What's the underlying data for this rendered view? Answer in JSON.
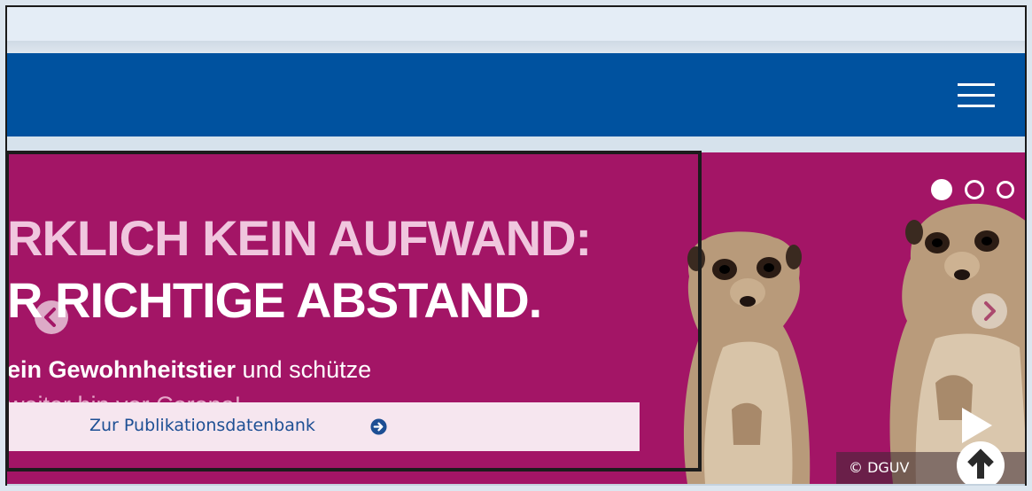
{
  "header": {
    "menu_icon": "hamburger-menu-icon",
    "colors": {
      "bar": "#00529f",
      "topbar": "#e4edf6"
    }
  },
  "hero": {
    "background": "#a31566",
    "headline_line1": "RKLICH KEIN AUFWAND:",
    "headline_line2": "R RICHTIGE ABSTAND.",
    "subline_bold": "ein Gewohnheitstier",
    "subline_rest": " und schütze",
    "subline_faded": "weiter hin vor Corona!",
    "cta": {
      "label": "Zur Publikationsdatenbank",
      "icon": "arrow-circle-right-icon"
    },
    "credit": "© DGUV",
    "slider": {
      "dot_count": 3,
      "active_index": 0
    },
    "icons": {
      "prev": "chevron-left-circle-icon",
      "next": "chevron-right-circle-icon",
      "play": "play-icon",
      "to_top": "arrow-up-circle-icon"
    }
  }
}
